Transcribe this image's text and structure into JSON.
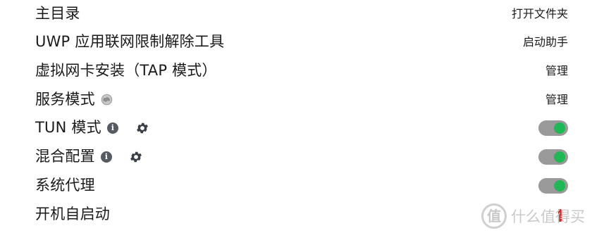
{
  "settings": {
    "rows": [
      {
        "label": "主目录",
        "action": "打开文件夹"
      },
      {
        "label": "UWP 应用联网限制解除工具",
        "action": "启动助手"
      },
      {
        "label": "虚拟网卡安装（TAP 模式）",
        "action": "管理"
      },
      {
        "label": "服务模式",
        "action": "管理",
        "icon": "globe-icon"
      },
      {
        "label": "TUN 模式",
        "toggle": true,
        "toggle_on": true,
        "icons": [
          "info-icon",
          "gear-icon"
        ]
      },
      {
        "label": "混合配置",
        "toggle": true,
        "toggle_on": true,
        "icons": [
          "info-icon",
          "gear-icon"
        ]
      },
      {
        "label": "系统代理",
        "toggle": true,
        "toggle_on": true
      },
      {
        "label": "开机自启动",
        "toggle": true,
        "toggle_on": false
      }
    ],
    "info_glyph": "i"
  },
  "colors": {
    "toggle_track": "#9a9a9a",
    "toggle_on_knob": "#1db954",
    "toggle_off_mark": "#d9262a"
  },
  "watermark": {
    "logo_glyph": "值",
    "text": "什么值得买"
  }
}
